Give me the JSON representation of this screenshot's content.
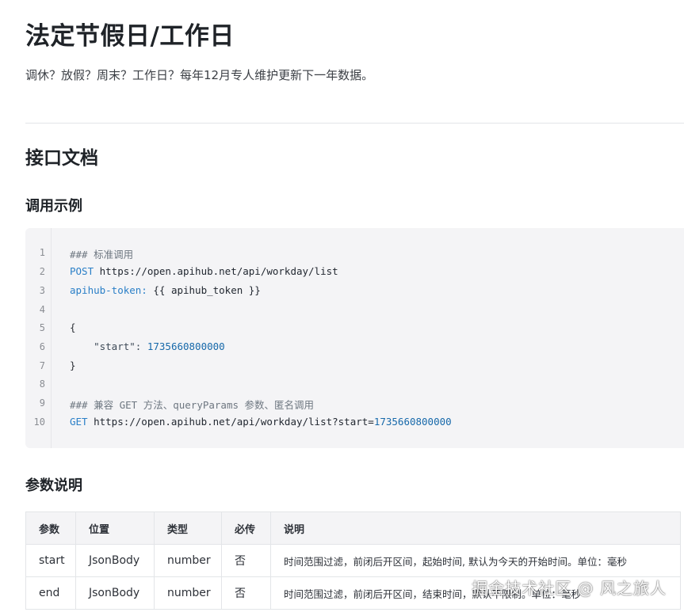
{
  "page": {
    "title": "法定节假日/工作日",
    "subtitle": "调休？放假？周末？工作日？每年12月专人维护更新下一年数据。"
  },
  "sections": {
    "api_doc": "接口文档",
    "example": "调用示例",
    "params": "参数说明"
  },
  "code": {
    "line_numbers": [
      "1",
      "2",
      "3",
      "4",
      "5",
      "6",
      "7",
      "8",
      "9",
      "10"
    ],
    "l1": "### 标准调用",
    "l2_method": "POST",
    "l2_url": " https://open.apihub.net/api/workday/list",
    "l3_key": "apihub-token:",
    "l3_val": " {{ apihub_token }}",
    "l5": "{",
    "l6_key": "    \"start\": ",
    "l6_val": "1735660800000",
    "l7": "}",
    "l9": "### 兼容 GET 方法、queryParams 参数、匿名调用",
    "l10_method": "GET",
    "l10_url": " https://open.apihub.net/api/workday/list?start=",
    "l10_val": "1735660800000"
  },
  "table": {
    "headers": [
      "参数",
      "位置",
      "类型",
      "必传",
      "说明"
    ],
    "rows": [
      [
        "start",
        "JsonBody",
        "number",
        "否",
        "时间范围过滤，前闭后开区间，起始时间, 默认为今天的开始时间。单位：毫秒"
      ],
      [
        "end",
        "JsonBody",
        "number",
        "否",
        "时间范围过滤，前闭后开区间，结束时间，默认不限制。单位：毫秒"
      ]
    ]
  },
  "watermark": "掘金技术社区 @ 风之旅人"
}
